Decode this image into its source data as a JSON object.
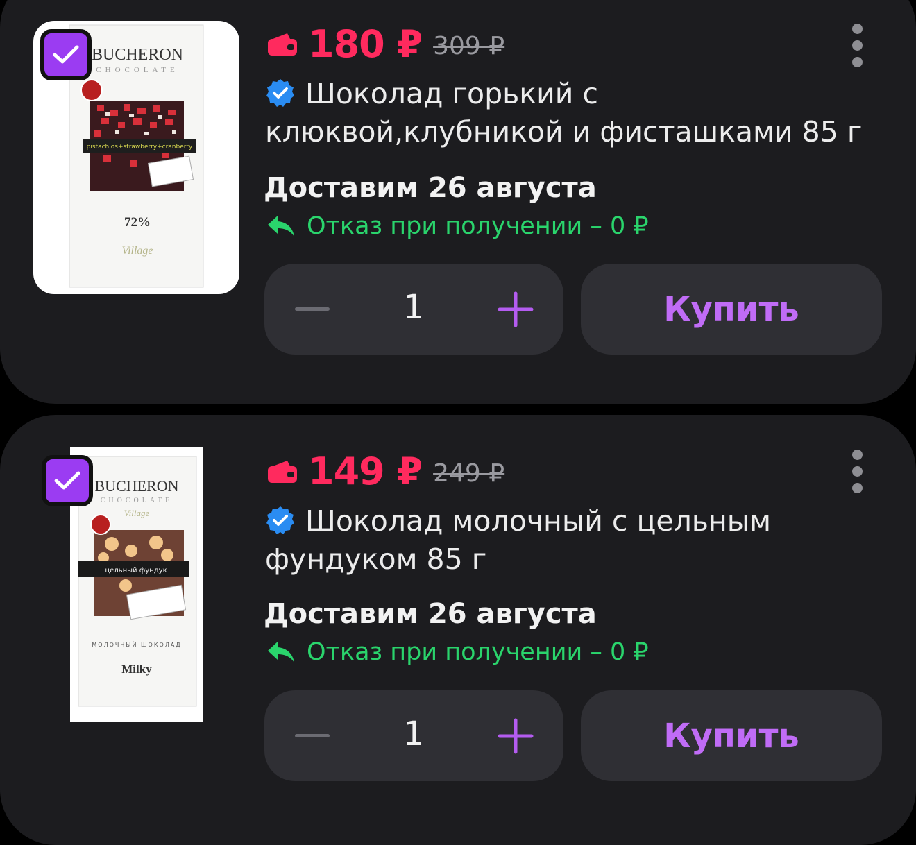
{
  "items": [
    {
      "price": "180 ₽",
      "old_price": "309 ₽",
      "title": "Шоколад горький с клюквой,клубникой и фисташками 85 г",
      "delivery": "Доставим 26 августа",
      "refund": "Отказ при получении – 0 ₽",
      "quantity": "1",
      "buy_label": "Купить",
      "image": {
        "brand": "BUCHERON",
        "brand_sub": "CHOCOLATE",
        "flavor": "pistachios+strawberry+cranberry",
        "percent": "72%",
        "script": "Village"
      }
    },
    {
      "price": "149 ₽",
      "old_price": "249 ₽",
      "title": "Шоколад молочный с цельным фундуком 85 г",
      "delivery": "Доставим 26 августа",
      "refund": "Отказ при получении – 0 ₽",
      "quantity": "1",
      "buy_label": "Купить",
      "image": {
        "brand": "BUCHERON",
        "brand_sub": "CHOCOLATE",
        "script": "Village",
        "flavor": "цельный фундук",
        "type_line": "МОЛОЧНЫЙ ШОКОЛАД",
        "variant": "Milky"
      }
    }
  ],
  "colors": {
    "price": "#ff2a5e",
    "accent": "#9b3cf2",
    "buy_text": "#c06cf6",
    "refund": "#2ad46c",
    "verified": "#2a8cf2"
  },
  "icons": [
    "check-icon",
    "wallet-icon",
    "verified-icon",
    "return-arrow-icon",
    "minus-icon",
    "plus-icon",
    "more-icon"
  ]
}
